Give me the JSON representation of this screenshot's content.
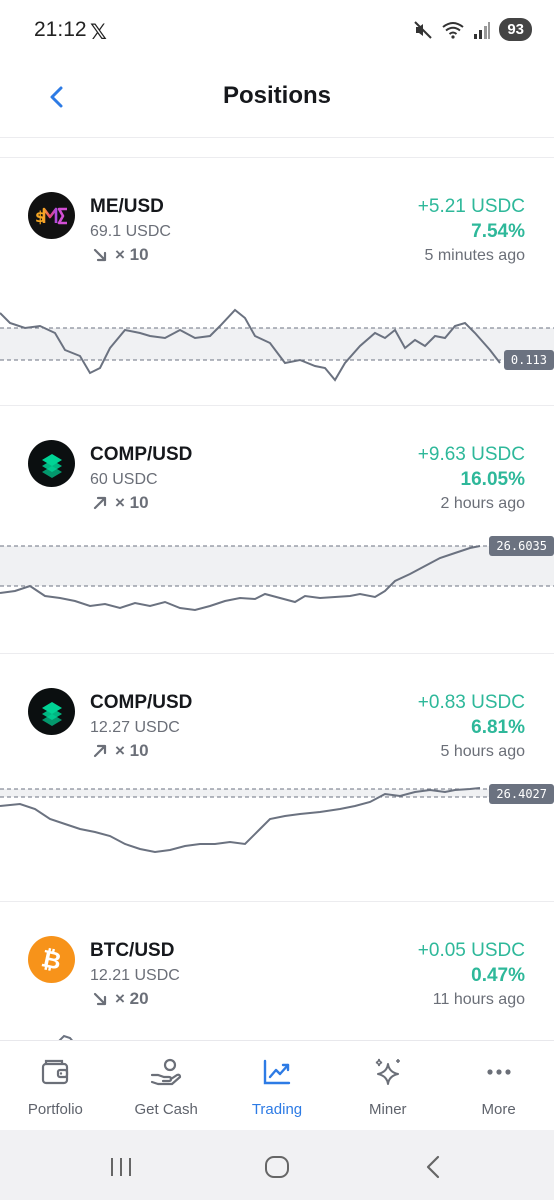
{
  "status_bar": {
    "time": "21:12",
    "app_notification_icon": "x-logo",
    "battery": "93",
    "icons": [
      "mute-icon",
      "wifi-icon",
      "signal-icon"
    ]
  },
  "header": {
    "title": "Positions",
    "back_icon": "chevron-left-icon"
  },
  "positions": [
    {
      "pair": "ME/USD",
      "amount": "69.1 USDC",
      "direction": "short",
      "direction_icon": "arrow-down-right-icon",
      "leverage": "× 10",
      "pnl": "+5.21 USDC",
      "pnl_percent": "7.54%",
      "time_ago": "5 minutes ago",
      "price_label": "0.113",
      "icon": "magic-eden-icon"
    },
    {
      "pair": "COMP/USD",
      "amount": "60 USDC",
      "direction": "long",
      "direction_icon": "arrow-up-right-icon",
      "leverage": "× 10",
      "pnl": "+9.63 USDC",
      "pnl_percent": "16.05%",
      "time_ago": "2 hours ago",
      "price_label": "26.6035",
      "icon": "compound-icon"
    },
    {
      "pair": "COMP/USD",
      "amount": "12.27 USDC",
      "direction": "long",
      "direction_icon": "arrow-up-right-icon",
      "leverage": "× 10",
      "pnl": "+0.83 USDC",
      "pnl_percent": "6.81%",
      "time_ago": "5 hours ago",
      "price_label": "26.4027",
      "icon": "compound-icon"
    },
    {
      "pair": "BTC/USD",
      "amount": "12.21 USDC",
      "direction": "short",
      "direction_icon": "arrow-down-right-icon",
      "leverage": "× 20",
      "pnl": "+0.05 USDC",
      "pnl_percent": "0.47%",
      "time_ago": "11 hours ago",
      "icon": "bitcoin-icon"
    }
  ],
  "bottom_nav": [
    {
      "label": "Portfolio",
      "icon": "wallet-icon",
      "active": false
    },
    {
      "label": "Get Cash",
      "icon": "hand-coin-icon",
      "active": false
    },
    {
      "label": "Trading",
      "icon": "trend-up-icon",
      "active": true
    },
    {
      "label": "Miner",
      "icon": "sparkles-icon",
      "active": false
    },
    {
      "label": "More",
      "icon": "more-dots-icon",
      "active": false
    }
  ],
  "colors": {
    "accent": "#2d7be5",
    "positive": "#2eb89a",
    "muted": "#6b6f78",
    "sparkline": "#6b7280"
  }
}
